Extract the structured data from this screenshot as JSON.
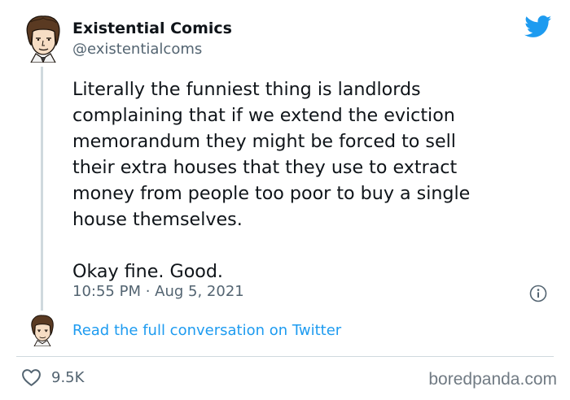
{
  "author": {
    "display_name": "Existential Comics",
    "handle": "@existentialcoms"
  },
  "tweet": {
    "paragraph_1": "Literally the funniest thing is landlords\ncomplaining that if we extend the eviction\nmemorandum they might be forced to sell\ntheir extra houses that they use to extract\nmoney from people too poor to buy a single\nhouse themselves.",
    "paragraph_2": "Okay fine. Good.",
    "timestamp": "10:55 PM · Aug 5, 2021"
  },
  "conversation_link": "Read the full conversation on Twitter",
  "engagement": {
    "likes": "9.5K"
  },
  "watermark": "boredpanda.com",
  "icons": {
    "brand": "twitter-bird-icon",
    "info": "info-icon",
    "like": "heart-icon"
  },
  "colors": {
    "text_primary": "#0f1419",
    "text_secondary": "#536471",
    "link_blue": "#1d9bf0",
    "twitter_blue": "#1d9bf0",
    "divider": "#cfd9de",
    "watermark": "#707a83"
  }
}
